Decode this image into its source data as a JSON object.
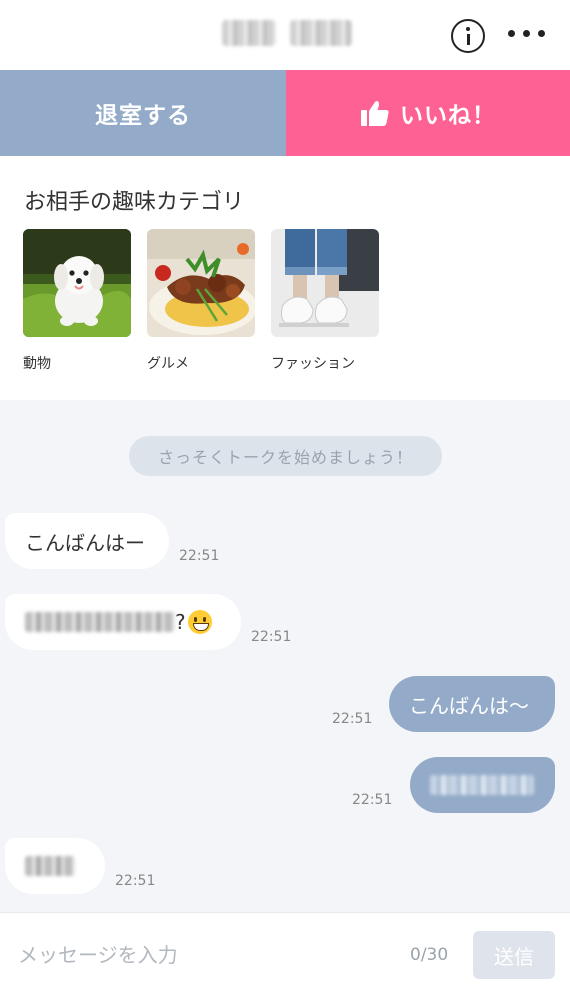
{
  "header": {
    "name": "",
    "info_icon": "info-icon",
    "more_icon": "more-icon"
  },
  "actions": {
    "leave_label": "退室する",
    "like_label": "いいね！",
    "like_icon": "thumbs-up-icon",
    "colors": {
      "leave": "#93abc8",
      "like": "#fe6193"
    }
  },
  "hobbies": {
    "title": "お相手の趣味カテゴリ",
    "categories": [
      {
        "label": "動物",
        "image": "dog-photo"
      },
      {
        "label": "グルメ",
        "image": "food-photo"
      },
      {
        "label": "ファッション",
        "image": "sneakers-photo"
      }
    ]
  },
  "chat": {
    "system_message": "さっそくトークを始めましょう！",
    "messages": [
      {
        "side": "in",
        "text": "こんばんはー",
        "time": "22:51"
      },
      {
        "side": "in",
        "text": "?",
        "blurred": true,
        "emoji": "grinning-face",
        "time": "22:51"
      },
      {
        "side": "out",
        "text": "こんばんは〜",
        "time": "22:51"
      },
      {
        "side": "out",
        "text": "",
        "blurred": true,
        "time": "22:51"
      },
      {
        "side": "in",
        "text": "",
        "blurred": true,
        "time": "22:51"
      }
    ]
  },
  "input": {
    "placeholder": "メッセージを入力",
    "counter": "0/30",
    "send_label": "送信"
  }
}
